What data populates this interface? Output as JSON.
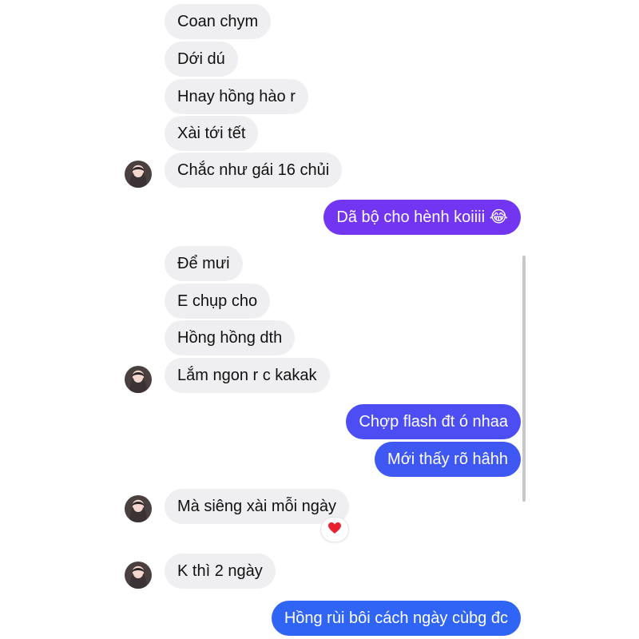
{
  "colors": {
    "incoming_bubble": "#efeff1",
    "outgoing_gradient_top": "#7a33f0",
    "outgoing_gradient_bottom": "#2f64f5",
    "reaction": "#e8232f"
  },
  "messages": [
    {
      "side": "in",
      "text": "Coan chym"
    },
    {
      "side": "in",
      "text": "Dới dú"
    },
    {
      "side": "in",
      "text": "Hnay hồng hào r"
    },
    {
      "side": "in",
      "text": "Xài tới tết"
    },
    {
      "side": "in",
      "text": "Chắc như gái 16 chủi"
    },
    {
      "side": "out",
      "text": "Dã bộ cho hènh koiiii 😂"
    },
    {
      "side": "in",
      "text": "Để mưi"
    },
    {
      "side": "in",
      "text": "E chụp cho"
    },
    {
      "side": "in",
      "text": "Hồng hồng dth"
    },
    {
      "side": "in",
      "text": "Lắm ngon r c kakak"
    },
    {
      "side": "out",
      "text": "Chợp flash đt ó nhaa"
    },
    {
      "side": "out",
      "text": "Mới thấy rõ hâhh"
    },
    {
      "side": "in",
      "text": "Mà siêng xài mỗi ngày"
    },
    {
      "side": "in",
      "text": "K thì 2 ngày"
    },
    {
      "side": "out",
      "text": "Hồng rùi bôi cách ngày cùbg đc"
    }
  ],
  "reaction": {
    "icon": "heart-icon"
  },
  "avatar": {
    "icon": "contact-avatar"
  }
}
